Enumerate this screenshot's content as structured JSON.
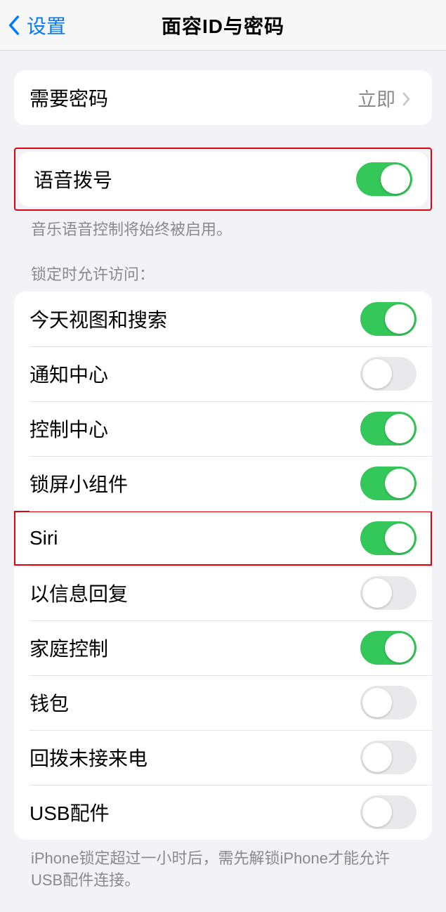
{
  "nav": {
    "back_label": "设置",
    "title": "面容ID与密码"
  },
  "group1": {
    "require_passcode": {
      "label": "需要密码",
      "value": "立即"
    }
  },
  "group2": {
    "voice_dial": {
      "label": "语音拨号",
      "on": true
    },
    "footer": "音乐语音控制将始终被启用。"
  },
  "lock_access": {
    "header": "锁定时允许访问：",
    "items": [
      {
        "label": "今天视图和搜索",
        "on": true
      },
      {
        "label": "通知中心",
        "on": false
      },
      {
        "label": "控制中心",
        "on": true
      },
      {
        "label": "锁屏小组件",
        "on": true
      },
      {
        "label": "Siri",
        "on": true,
        "highlight": true
      },
      {
        "label": "以信息回复",
        "on": false
      },
      {
        "label": "家庭控制",
        "on": true
      },
      {
        "label": "钱包",
        "on": false
      },
      {
        "label": "回拨未接来电",
        "on": false
      },
      {
        "label": "USB配件",
        "on": false
      }
    ],
    "footer": "iPhone锁定超过一小时后，需先解锁iPhone才能允许USB配件连接。"
  }
}
